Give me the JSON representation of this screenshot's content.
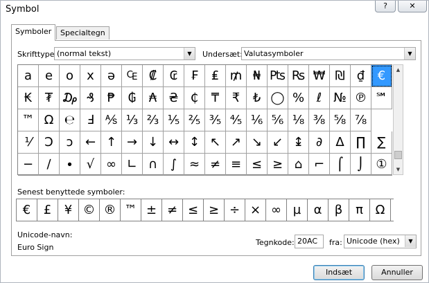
{
  "window": {
    "title": "Symbol",
    "help_label": "?",
    "close_label": "✕"
  },
  "tabs": [
    {
      "label": "Symboler"
    },
    {
      "label": "Specialtegn"
    }
  ],
  "font": {
    "label": "Skrifttype:",
    "value": "(normal tekst)"
  },
  "subset": {
    "label": "Undersæt:",
    "value": "Valutasymboler"
  },
  "symbol_grid": {
    "rows": [
      [
        "a",
        "e",
        "o",
        "x",
        "ə",
        "₠",
        "₡",
        "₢",
        "₣",
        "₤",
        "₥",
        "₦",
        "₧",
        "₨",
        "₩",
        "₪",
        "₫",
        "€"
      ],
      [
        "₭",
        "₮",
        "₯",
        "₰",
        "₱",
        "₲",
        "₳",
        "₴",
        "₵",
        "₸",
        "₹",
        "₺",
        "◯",
        "%",
        "ℓ",
        "№",
        "℗",
        "℠"
      ],
      [
        "™",
        "Ω",
        "℮",
        "Ⅎ",
        "⅍",
        "⅓",
        "⅔",
        "⅕",
        "⅖",
        "⅗",
        "⅘",
        "⅙",
        "⅚",
        "⅛",
        "⅜",
        "⅝",
        "⅞"
      ],
      [
        "⅟",
        "Ↄ",
        "ↄ",
        "←",
        "↑",
        "→",
        "↓",
        "↔",
        "↕",
        "↖",
        "↗",
        "↘",
        "↙",
        "↨",
        "∂",
        "∆",
        "∏",
        "∑"
      ],
      [
        "−",
        "∕",
        "∙",
        "√",
        "∞",
        "∟",
        "∩",
        "∫",
        "≈",
        "≠",
        "≡",
        "≤",
        "≥",
        "⌂",
        "⌐",
        "⌠",
        "⌡",
        "①"
      ]
    ],
    "selected": "€"
  },
  "recent": {
    "label": "Senest benyttede symboler:",
    "symbols": [
      "€",
      "£",
      "¥",
      "©",
      "®",
      "™",
      "±",
      "≠",
      "≤",
      "≥",
      "÷",
      "×",
      "∞",
      "µ",
      "α",
      "β",
      "π",
      "Ω"
    ]
  },
  "unicode": {
    "label": "Unicode-navn:",
    "name": "Euro Sign"
  },
  "charcode": {
    "label": "Tegnkode:",
    "value": "20AC"
  },
  "from": {
    "label": "fra:",
    "value": "Unicode (hex)"
  },
  "buttons": {
    "insert": "Indsæt",
    "cancel": "Annuller"
  }
}
